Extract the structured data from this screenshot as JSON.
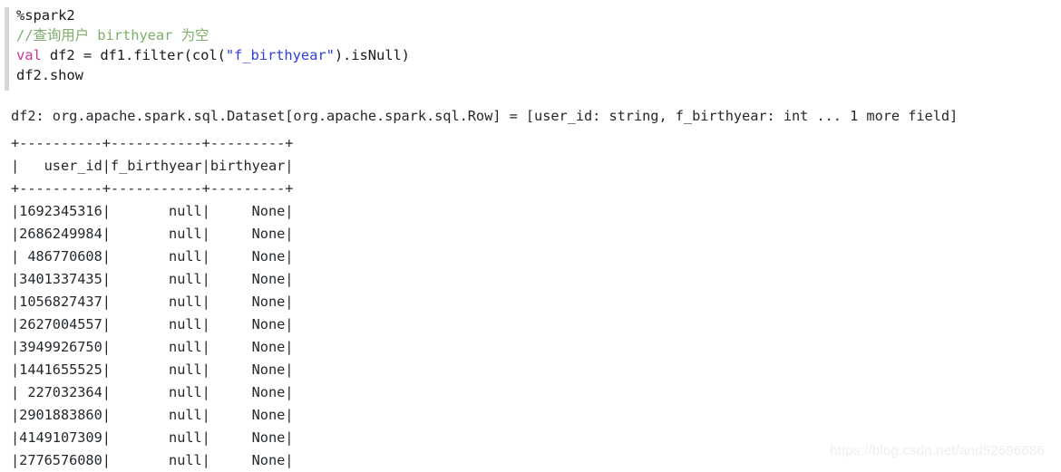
{
  "code_cell": {
    "interpreter_directive": "%spark2",
    "comment": "//查询用户 birthyear 为空",
    "statement": {
      "keyword": "val",
      "before_string": " df2 = df1.filter(col(",
      "string": "\"f_birthyear\"",
      "after_string": ").isNull)"
    },
    "show_call": "df2.show"
  },
  "output": {
    "schema_line": "df2: org.apache.spark.sql.Dataset[org.apache.spark.sql.Row] = [user_id: string, f_birthyear: int ... 1 more field]",
    "separator": "+----------+-----------+---------+",
    "header": "|   user_id|f_birthyear|birthyear|",
    "columns": [
      "user_id",
      "f_birthyear",
      "birthyear"
    ],
    "rows": [
      "|1692345316|       null|     None|",
      "|2686249984|       null|     None|",
      "| 486770608|       null|     None|",
      "|3401337435|       null|     None|",
      "|1056827437|       null|     None|",
      "|2627004557|       null|     None|",
      "|3949926750|       null|     None|",
      "|1441655525|       null|     None|",
      "| 227032364|       null|     None|",
      "|2901883860|       null|     None|",
      "|4149107309|       null|     None|",
      "|2776576080|       null|     None|"
    ],
    "row_values": [
      {
        "user_id": "1692345316",
        "f_birthyear": "null",
        "birthyear": "None"
      },
      {
        "user_id": "2686249984",
        "f_birthyear": "null",
        "birthyear": "None"
      },
      {
        "user_id": "486770608",
        "f_birthyear": "null",
        "birthyear": "None"
      },
      {
        "user_id": "3401337435",
        "f_birthyear": "null",
        "birthyear": "None"
      },
      {
        "user_id": "1056827437",
        "f_birthyear": "null",
        "birthyear": "None"
      },
      {
        "user_id": "2627004557",
        "f_birthyear": "null",
        "birthyear": "None"
      },
      {
        "user_id": "3949926750",
        "f_birthyear": "null",
        "birthyear": "None"
      },
      {
        "user_id": "1441655525",
        "f_birthyear": "null",
        "birthyear": "None"
      },
      {
        "user_id": "227032364",
        "f_birthyear": "null",
        "birthyear": "None"
      },
      {
        "user_id": "2901883860",
        "f_birthyear": "null",
        "birthyear": "None"
      },
      {
        "user_id": "4149107309",
        "f_birthyear": "null",
        "birthyear": "None"
      },
      {
        "user_id": "2776576080",
        "f_birthyear": "null",
        "birthyear": "None"
      }
    ]
  },
  "watermark": {
    "text": "https://blog.csdn.net/and52696686"
  },
  "colors": {
    "background": "#ffffff",
    "code_text": "#1b1b1b",
    "comment": "#7fae6d",
    "keyword": "#c4379c",
    "string": "#2f41d8",
    "output_text": "#24292e",
    "gutter": "#d6d6d6",
    "watermark": "#eeeeee"
  }
}
